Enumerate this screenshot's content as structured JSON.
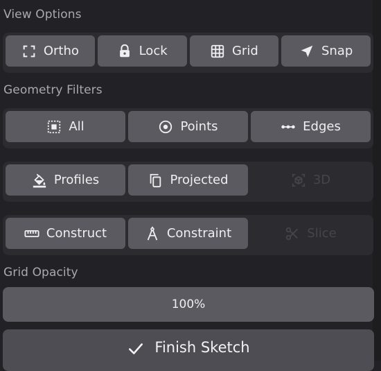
{
  "view_options": {
    "label": "View Options",
    "buttons": [
      {
        "label": "Ortho",
        "icon": "ortho-frame-icon"
      },
      {
        "label": "Lock",
        "icon": "lock-icon"
      },
      {
        "label": "Grid",
        "icon": "grid-icon"
      },
      {
        "label": "Snap",
        "icon": "navigation-arrow-icon"
      }
    ]
  },
  "geometry_filters": {
    "label": "Geometry Filters",
    "rows": [
      [
        {
          "label": "All",
          "icon": "select-all-icon",
          "enabled": true
        },
        {
          "label": "Points",
          "icon": "point-target-icon",
          "enabled": true
        },
        {
          "label": "Edges",
          "icon": "edge-dots-icon",
          "enabled": true
        }
      ],
      [
        {
          "label": "Profiles",
          "icon": "paint-bucket-icon",
          "enabled": true
        },
        {
          "label": "Projected",
          "icon": "copy-layers-icon",
          "enabled": true
        },
        {
          "label": "3D",
          "icon": "cube-3d-icon",
          "enabled": false
        }
      ],
      [
        {
          "label": "Construct",
          "icon": "ruler-icon",
          "enabled": true
        },
        {
          "label": "Constraint",
          "icon": "compass-icon",
          "enabled": true
        },
        {
          "label": "Slice",
          "icon": "scissors-icon",
          "enabled": false
        }
      ]
    ]
  },
  "grid_opacity": {
    "label": "Grid Opacity",
    "value": "100%",
    "level": 1.0
  },
  "finish": {
    "label": "Finish Sketch",
    "icon": "checkmark-icon"
  },
  "colors": {
    "background": "#222226",
    "panel": "#2b2b30",
    "button": "#5a5a60",
    "text": "#efeff1",
    "muted_label": "#a9a9ae",
    "disabled_text": "#45454a"
  }
}
